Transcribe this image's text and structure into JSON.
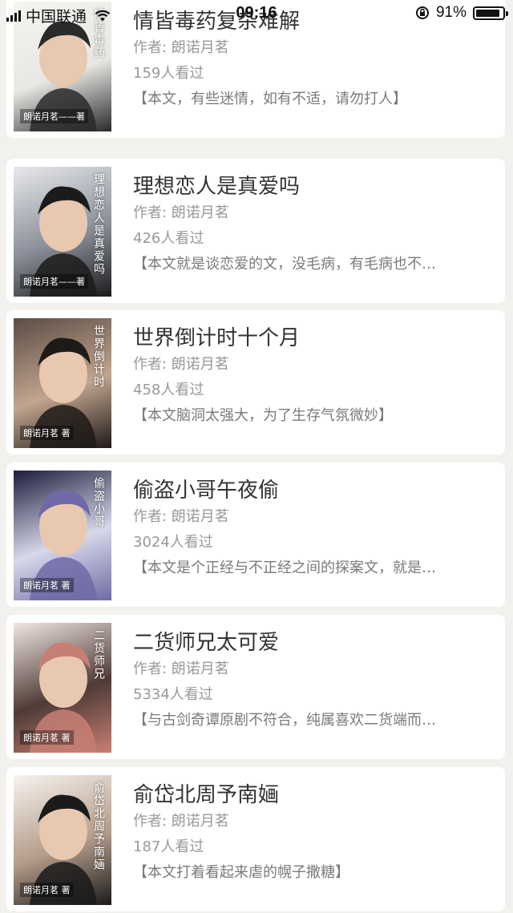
{
  "status_bar": {
    "carrier": "中国联通",
    "time": "09:16",
    "battery": "91%",
    "battery_level": 0.91
  },
  "books": [
    {
      "title": "情皆毒药复杂难解",
      "author": "作者: 朗诺月茗",
      "views": "159人看过",
      "desc": "【本文，有些迷情，如有不适，请勿打人】",
      "cover_text": "情皆毒药",
      "cover_author": "朗诺月茗——著",
      "cover_colors": [
        "#f6f4f1",
        "#2a2a2a",
        "#e9e7e4"
      ]
    },
    {
      "title": "理想恋人是真爱吗",
      "author": "作者: 朗诺月茗",
      "views": "426人看过",
      "desc": "【本文就是谈恋爱的文，没毛病，有毛病也不…",
      "cover_text": "理想恋人是真爱吗",
      "cover_author": "朗诺月茗——著",
      "cover_colors": [
        "#e8e9ec",
        "#1b1b1b",
        "#8a8f99"
      ]
    },
    {
      "title": "世界倒计时十个月",
      "author": "作者: 朗诺月茗",
      "views": "458人看过",
      "desc": "【本文脑洞太强大，为了生存气氛微妙】",
      "cover_text": "世界倒计时",
      "cover_author": "朗诺月茗 著",
      "cover_colors": [
        "#5b4c44",
        "#1e1a18",
        "#c2a58f"
      ]
    },
    {
      "title": "偷盗小哥午夜偷",
      "author": "作者: 朗诺月茗",
      "views": "3024人看过",
      "desc": "【本文是个正经与不正经之间的探案文，就是…",
      "cover_text": "偷盗小哥",
      "cover_author": "朗诺月茗 著",
      "cover_colors": [
        "#1d1c3c",
        "#6f6aa6",
        "#d7d8ea"
      ]
    },
    {
      "title": "二货师兄太可爱",
      "author": "作者: 朗诺月茗",
      "views": "5334人看过",
      "desc": "【与古剑奇谭原剧不符合，纯属喜欢二货端而…",
      "cover_text": "二货师兄",
      "cover_author": "朗诺月茗 著",
      "cover_colors": [
        "#f1e6e1",
        "#c77f74",
        "#4f3b36"
      ]
    },
    {
      "title": "俞岱北周予南婳",
      "author": "作者: 朗诺月茗",
      "views": "187人看过",
      "desc": "【本文打着看起来虐的幌子撒糖】",
      "cover_text": "俞岱北周予南婳",
      "cover_author": "朗诺月茗 著",
      "cover_colors": [
        "#f7f3ee",
        "#1a1a1a",
        "#b49c8a"
      ]
    }
  ]
}
